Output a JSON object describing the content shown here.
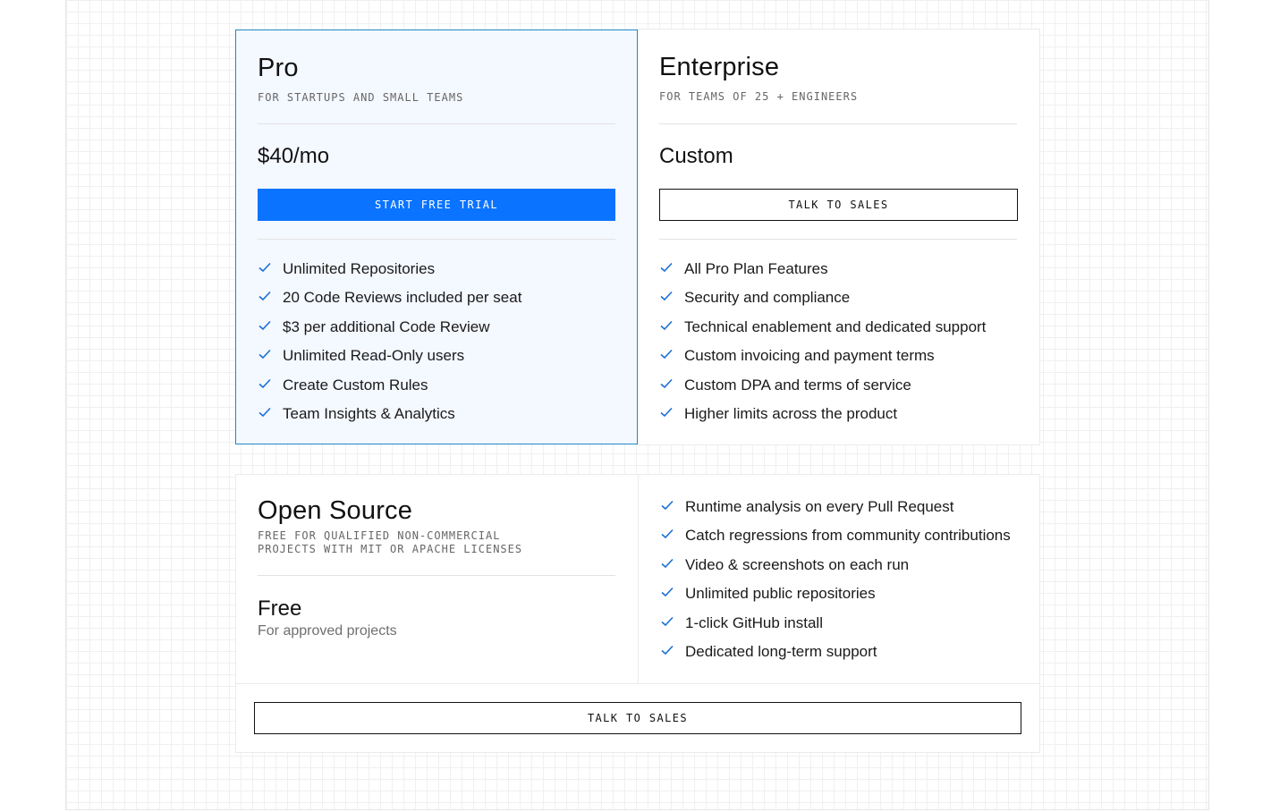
{
  "plans": {
    "pro": {
      "name": "Pro",
      "subtitle": "FOR STARTUPS AND SMALL TEAMS",
      "price": "$40/mo",
      "cta": "START FREE TRIAL",
      "features": [
        "Unlimited Repositories",
        "20 Code Reviews included per seat",
        "$3 per additional Code Review",
        "Unlimited Read-Only users",
        "Create Custom Rules",
        "Team Insights & Analytics"
      ]
    },
    "enterprise": {
      "name": "Enterprise",
      "subtitle": "FOR TEAMS OF 25 + ENGINEERS",
      "price": "Custom",
      "cta": "TALK TO SALES",
      "features": [
        "All Pro Plan Features",
        "Security and compliance",
        "Technical enablement and dedicated support",
        "Custom invoicing and payment terms",
        "Custom DPA and terms of service",
        "Higher limits across the product"
      ]
    },
    "open_source": {
      "name": "Open Source",
      "subtitle_line1": "FREE FOR QUALIFIED NON-COMMERCIAL",
      "subtitle_line2": "PROJECTS WITH MIT OR APACHE LICENSES",
      "price": "Free",
      "price_note": "For approved projects",
      "cta": "TALK TO SALES",
      "features": [
        "Runtime analysis on every Pull Request",
        "Catch regressions from community contributions",
        "Video & screenshots on each run",
        "Unlimited public repositories",
        "1-click GitHub install",
        "Dedicated long-term support"
      ]
    }
  },
  "colors": {
    "accent": "#0a73ff",
    "pro_border": "#1e88c8",
    "pro_background": "#f4f8ff",
    "check": "#1a6fd6"
  },
  "icons": {
    "feature": "check-icon"
  }
}
